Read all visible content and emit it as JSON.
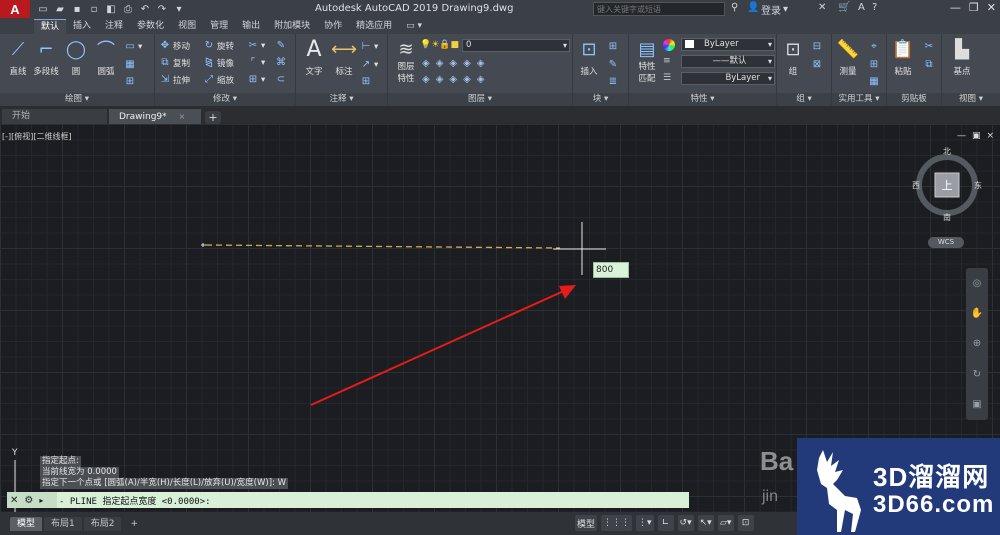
{
  "app": {
    "title": "Autodesk AutoCAD 2019    Drawing9.dwg",
    "logo": "A",
    "search_placeholder": "键入关键字或短语",
    "login": "登录",
    "help": "?"
  },
  "ribbon_tabs": [
    "默认",
    "插入",
    "注释",
    "参数化",
    "视图",
    "管理",
    "输出",
    "附加模块",
    "协作",
    "精选应用",
    "▭ ▾"
  ],
  "ribbon": {
    "draw": {
      "title": "绘图 ▾",
      "line": "直线",
      "polyline": "多段线",
      "circle": "圆",
      "arc": "圆弧"
    },
    "modify": {
      "title": "修改 ▾",
      "move": "移动",
      "rotate": "旋转",
      "copy": "复制",
      "mirror": "镜像",
      "stretch": "拉伸",
      "scale": "缩放"
    },
    "annotation": {
      "title": "注释 ▾",
      "text": "文字",
      "dimension": "标注"
    },
    "layers": {
      "title": "图层 ▾",
      "layer_props": "图层\n特性",
      "layer_value": "0"
    },
    "block": {
      "title": "块 ▾",
      "insert": "插入"
    },
    "properties": {
      "title": "特性 ▾",
      "match": "特性\n匹配",
      "color": "ByLayer",
      "linetype": "默认",
      "lineweight": "ByLayer"
    },
    "groups": {
      "title": "组 ▾",
      "group": "组"
    },
    "utilities": {
      "title": "实用工具 ▾",
      "measure": "测量"
    },
    "clipboard": {
      "title": "剪贴板",
      "paste": "粘贴"
    },
    "view": {
      "title": "视图 ▾",
      "base": "基点"
    }
  },
  "doc_tabs": {
    "start": "开始",
    "drawing": "Drawing9*",
    "close": "×",
    "add": "+"
  },
  "viewport": {
    "label": "[-][俯视][二维线框]",
    "controls": [
      "—",
      "▣",
      "×"
    ],
    "viewcube": {
      "top": "上",
      "north": "北",
      "south": "南",
      "east": "东",
      "west": "西"
    },
    "wcs": "WCS",
    "dynamic_input": "800",
    "ucs_y": "Y"
  },
  "command": {
    "history": [
      "指定起点:",
      "当前线宽为 0.0000",
      "指定下一个点或 [圆弧(A)/半宽(H)/长度(L)/放弃(U)/宽度(W)]: W"
    ],
    "prompt": "- PLINE 指定起点宽度 <0.0000>:",
    "close_icon": "✕",
    "settings_icon": "🔧"
  },
  "layout_tabs": [
    "模型",
    "布局1",
    "布局2",
    "+"
  ],
  "status": {
    "model": "模型",
    "grid": "⋮⋮⋮"
  },
  "watermark": {
    "brand1": "3D溜溜网",
    "brand2": "3D66.com",
    "baidu": "Ba",
    "baidu2": "jin"
  },
  "colors": {
    "accent": "#b8191e",
    "polyline": "#d6a94a",
    "arrow": "#e81b1b",
    "grid": "#2b2f36"
  }
}
